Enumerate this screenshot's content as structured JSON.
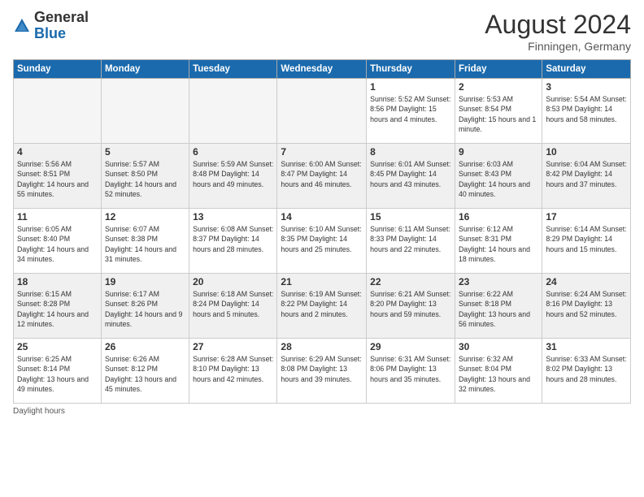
{
  "header": {
    "logo_general": "General",
    "logo_blue": "Blue",
    "month_title": "August 2024",
    "location": "Finningen, Germany"
  },
  "days_of_week": [
    "Sunday",
    "Monday",
    "Tuesday",
    "Wednesday",
    "Thursday",
    "Friday",
    "Saturday"
  ],
  "weeks": [
    [
      {
        "day": "",
        "info": ""
      },
      {
        "day": "",
        "info": ""
      },
      {
        "day": "",
        "info": ""
      },
      {
        "day": "",
        "info": ""
      },
      {
        "day": "1",
        "info": "Sunrise: 5:52 AM\nSunset: 8:56 PM\nDaylight: 15 hours\nand 4 minutes."
      },
      {
        "day": "2",
        "info": "Sunrise: 5:53 AM\nSunset: 8:54 PM\nDaylight: 15 hours\nand 1 minute."
      },
      {
        "day": "3",
        "info": "Sunrise: 5:54 AM\nSunset: 8:53 PM\nDaylight: 14 hours\nand 58 minutes."
      }
    ],
    [
      {
        "day": "4",
        "info": "Sunrise: 5:56 AM\nSunset: 8:51 PM\nDaylight: 14 hours\nand 55 minutes."
      },
      {
        "day": "5",
        "info": "Sunrise: 5:57 AM\nSunset: 8:50 PM\nDaylight: 14 hours\nand 52 minutes."
      },
      {
        "day": "6",
        "info": "Sunrise: 5:59 AM\nSunset: 8:48 PM\nDaylight: 14 hours\nand 49 minutes."
      },
      {
        "day": "7",
        "info": "Sunrise: 6:00 AM\nSunset: 8:47 PM\nDaylight: 14 hours\nand 46 minutes."
      },
      {
        "day": "8",
        "info": "Sunrise: 6:01 AM\nSunset: 8:45 PM\nDaylight: 14 hours\nand 43 minutes."
      },
      {
        "day": "9",
        "info": "Sunrise: 6:03 AM\nSunset: 8:43 PM\nDaylight: 14 hours\nand 40 minutes."
      },
      {
        "day": "10",
        "info": "Sunrise: 6:04 AM\nSunset: 8:42 PM\nDaylight: 14 hours\nand 37 minutes."
      }
    ],
    [
      {
        "day": "11",
        "info": "Sunrise: 6:05 AM\nSunset: 8:40 PM\nDaylight: 14 hours\nand 34 minutes."
      },
      {
        "day": "12",
        "info": "Sunrise: 6:07 AM\nSunset: 8:38 PM\nDaylight: 14 hours\nand 31 minutes."
      },
      {
        "day": "13",
        "info": "Sunrise: 6:08 AM\nSunset: 8:37 PM\nDaylight: 14 hours\nand 28 minutes."
      },
      {
        "day": "14",
        "info": "Sunrise: 6:10 AM\nSunset: 8:35 PM\nDaylight: 14 hours\nand 25 minutes."
      },
      {
        "day": "15",
        "info": "Sunrise: 6:11 AM\nSunset: 8:33 PM\nDaylight: 14 hours\nand 22 minutes."
      },
      {
        "day": "16",
        "info": "Sunrise: 6:12 AM\nSunset: 8:31 PM\nDaylight: 14 hours\nand 18 minutes."
      },
      {
        "day": "17",
        "info": "Sunrise: 6:14 AM\nSunset: 8:29 PM\nDaylight: 14 hours\nand 15 minutes."
      }
    ],
    [
      {
        "day": "18",
        "info": "Sunrise: 6:15 AM\nSunset: 8:28 PM\nDaylight: 14 hours\nand 12 minutes."
      },
      {
        "day": "19",
        "info": "Sunrise: 6:17 AM\nSunset: 8:26 PM\nDaylight: 14 hours\nand 9 minutes."
      },
      {
        "day": "20",
        "info": "Sunrise: 6:18 AM\nSunset: 8:24 PM\nDaylight: 14 hours\nand 5 minutes."
      },
      {
        "day": "21",
        "info": "Sunrise: 6:19 AM\nSunset: 8:22 PM\nDaylight: 14 hours\nand 2 minutes."
      },
      {
        "day": "22",
        "info": "Sunrise: 6:21 AM\nSunset: 8:20 PM\nDaylight: 13 hours\nand 59 minutes."
      },
      {
        "day": "23",
        "info": "Sunrise: 6:22 AM\nSunset: 8:18 PM\nDaylight: 13 hours\nand 56 minutes."
      },
      {
        "day": "24",
        "info": "Sunrise: 6:24 AM\nSunset: 8:16 PM\nDaylight: 13 hours\nand 52 minutes."
      }
    ],
    [
      {
        "day": "25",
        "info": "Sunrise: 6:25 AM\nSunset: 8:14 PM\nDaylight: 13 hours\nand 49 minutes."
      },
      {
        "day": "26",
        "info": "Sunrise: 6:26 AM\nSunset: 8:12 PM\nDaylight: 13 hours\nand 45 minutes."
      },
      {
        "day": "27",
        "info": "Sunrise: 6:28 AM\nSunset: 8:10 PM\nDaylight: 13 hours\nand 42 minutes."
      },
      {
        "day": "28",
        "info": "Sunrise: 6:29 AM\nSunset: 8:08 PM\nDaylight: 13 hours\nand 39 minutes."
      },
      {
        "day": "29",
        "info": "Sunrise: 6:31 AM\nSunset: 8:06 PM\nDaylight: 13 hours\nand 35 minutes."
      },
      {
        "day": "30",
        "info": "Sunrise: 6:32 AM\nSunset: 8:04 PM\nDaylight: 13 hours\nand 32 minutes."
      },
      {
        "day": "31",
        "info": "Sunrise: 6:33 AM\nSunset: 8:02 PM\nDaylight: 13 hours\nand 28 minutes."
      }
    ]
  ],
  "footer": {
    "label": "Daylight hours"
  }
}
